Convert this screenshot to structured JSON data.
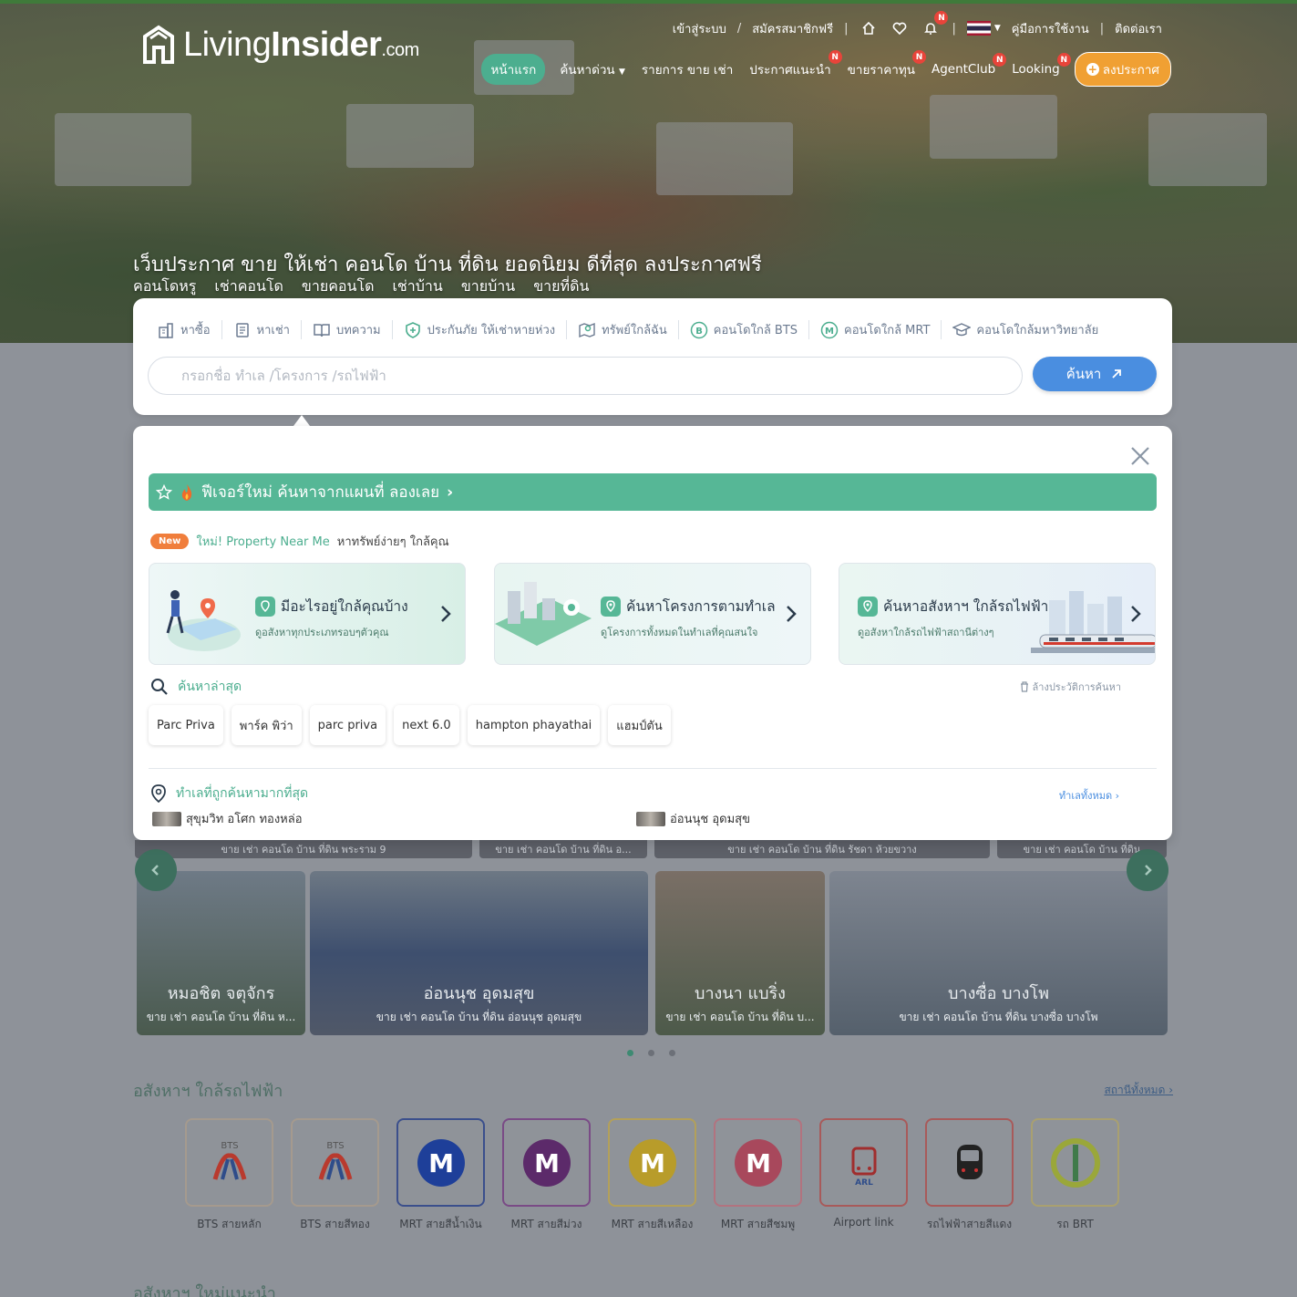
{
  "brand": {
    "logo_text_light": "Living",
    "logo_text_bold": "Insider",
    "logo_suffix": ".com"
  },
  "topbar": {
    "login": "เข้าสู่ระบบ",
    "register": "สมัครสมาชิกฟรี",
    "guide": "คู่มือการใช้งาน",
    "contact": "ติดต่อเรา",
    "notif_badge": "N"
  },
  "nav": {
    "home": "หน้าแรก",
    "quick_search": "ค้นหาด่วน",
    "listings": "รายการ ขาย เช่า",
    "recommended": "ประกาศแนะนำ",
    "below_price": "ขายราคาทุน",
    "agentclub": "AgentClub",
    "looking": "Looking",
    "post": "ลงประกาศ",
    "badge": "N"
  },
  "hero": {
    "title": "เว็บประกาศ ขาย ให้เช่า คอนโด บ้าน ที่ดิน ยอดนิยม ดีที่สุด ลงประกาศฟรี",
    "links": [
      "คอนโดหรู",
      "เช่าคอนโด",
      "ขายคอนโด",
      "เช่าบ้าน",
      "ขายบ้าน",
      "ขายที่ดิน"
    ]
  },
  "search": {
    "tabs": [
      {
        "label": "หาซื้อ",
        "icon": "building-icon"
      },
      {
        "label": "หาเช่า",
        "icon": "document-icon"
      },
      {
        "label": "บทความ",
        "icon": "book-icon"
      },
      {
        "label": "ประกันภัย ให้เช่าหายห่วง",
        "icon": "shield-plus-icon"
      },
      {
        "label": "ทรัพย์ใกล้ฉัน",
        "icon": "map-pin-icon"
      },
      {
        "label": "คอนโดใกล้ BTS",
        "icon": "bts-b-icon"
      },
      {
        "label": "คอนโดใกล้ MRT",
        "icon": "mrt-m-icon"
      },
      {
        "label": "คอนโดใกล้มหาวิทยาลัย",
        "icon": "graduation-cap-icon"
      }
    ],
    "placeholder": "กรอกชื่อ ทำเล /โครงการ /รถไฟฟ้า",
    "button": "ค้นหา"
  },
  "panel": {
    "feature_bar": "ฟีเจอร์ใหม่ ค้นหาจากแผนที่ ลองเลย",
    "new_badge": "New",
    "new_highlight": "ใหม่! Property Near Me",
    "new_text": "หาทรัพย์ง่ายๆ ใกล้คุณ",
    "promos": [
      {
        "title": "มีอะไรอยู่ใกล้คุณบ้าง",
        "sub": "ดูอสังหาทุกประเภทรอบๆตัวคุณ"
      },
      {
        "title": "ค้นหาโครงการตามทำเล",
        "sub": "ดูโครงการทั้งหมดในทำเลที่คุณสนใจ"
      },
      {
        "title": "ค้นหาอสังหาฯ ใกล้รถไฟฟ้า",
        "sub": "ดูอสังหาใกล้รถไฟฟ้าสถานีต่างๆ"
      }
    ],
    "recent_title": "ค้นหาล่าสุด",
    "clear_history": "ล้างประวัติการค้นหา",
    "recent": [
      "Parc Priva",
      "พาร์ค พิว่า",
      "parc priva",
      "next 6.0",
      "hampton phayathai",
      "แฮมป์ตัน"
    ],
    "popular_title": "ทำเลที่ถูกค้นหามากที่สุด",
    "all_areas": "ทำเลทั้งหมด",
    "popular": [
      "สุขุมวิท อโศก ทองหล่อ",
      "อ่อนนุช อุดมสุข"
    ]
  },
  "behind": {
    "strips": [
      "ขาย เช่า คอนโด บ้าน ที่ดิน พระราม 9",
      "ขาย เช่า คอนโด บ้าน ที่ดิน อ...",
      "ขาย เช่า คอนโด บ้าน ที่ดิน รัชดา ห้วยขวาง",
      "ขาย เช่า คอนโด บ้าน ที่ดิน"
    ],
    "areas": [
      {
        "name": "หมอชิต จตุจักร",
        "sub": "ขาย เช่า คอนโด บ้าน ที่ดิน ห..."
      },
      {
        "name": "อ่อนนุช อุดมสุข",
        "sub": "ขาย เช่า คอนโด บ้าน ที่ดิน อ่อนนุช อุดมสุข"
      },
      {
        "name": "บางนา แบริ่ง",
        "sub": "ขาย เช่า คอนโด บ้าน ที่ดิน บ..."
      },
      {
        "name": "บางซื่อ บางโพ",
        "sub": "ขาย เช่า คอนโด บ้าน ที่ดิน บางซื่อ บางโพ"
      }
    ],
    "section_title": "อสังหาฯ ใกล้รถไฟฟ้า",
    "see_all": "สถานีทั้งหมด",
    "lines": [
      {
        "label": "BTS สายหลัก",
        "color": "#d33a2e"
      },
      {
        "label": "BTS สายสีทอง",
        "color": "#d33a2e"
      },
      {
        "label": "MRT สายสีน้ำเงิน",
        "color": "#1e3f99"
      },
      {
        "label": "MRT สายสีม่วง",
        "color": "#6b2c7a"
      },
      {
        "label": "MRT สายสีเหลือง",
        "color": "#d6b21c"
      },
      {
        "label": "MRT สายสีชมพู",
        "color": "#c9506b"
      },
      {
        "label": "Airport link",
        "color": "#c43a3a"
      },
      {
        "label": "รถไฟฟ้าสายสีแดง",
        "color": "#333333"
      },
      {
        "label": "รถ BRT",
        "color": "#9bbf3a"
      }
    ],
    "section_title2": "อสังหาฯ ใหม่แนะนำ"
  },
  "colors": {
    "accent_green": "#56b796",
    "accent_blue": "#4a8ee0",
    "accent_orange": "#f0a033"
  }
}
